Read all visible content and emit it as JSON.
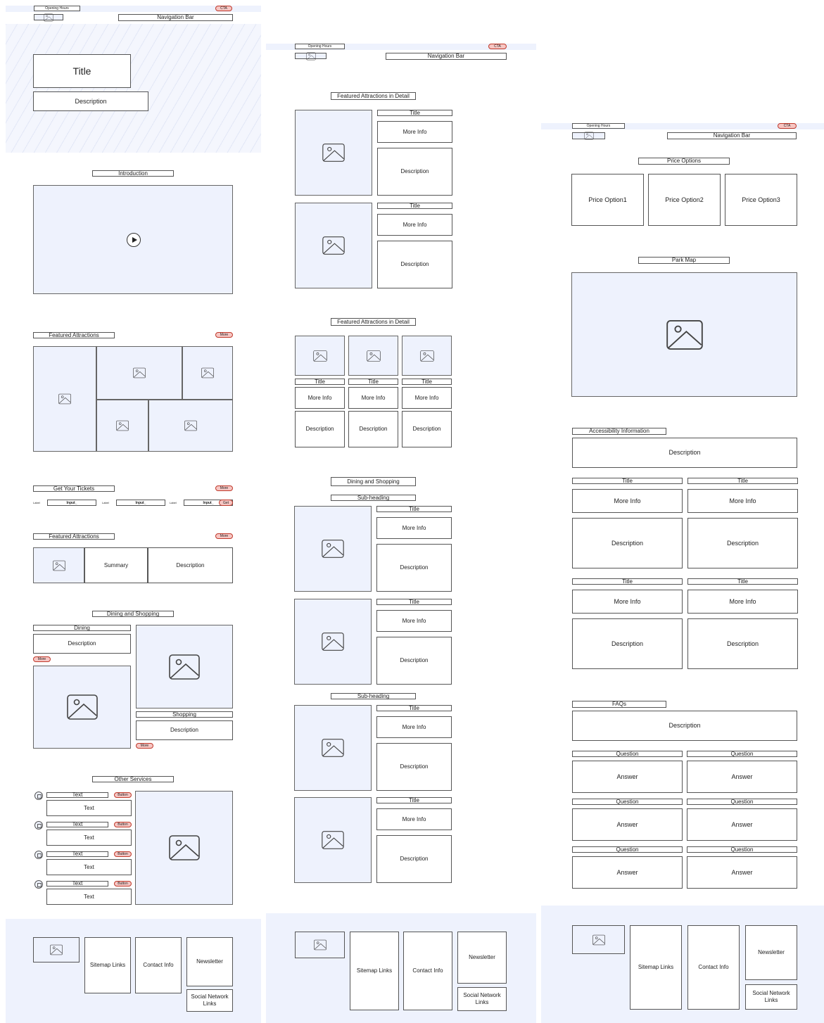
{
  "common": {
    "opening_hours": "Opening Hours",
    "cta": "CTA",
    "navigation_bar": "Navigation Bar",
    "more": "More",
    "title": "Title",
    "more_info": "More Info",
    "description": "Description",
    "footer": {
      "sitemap": "Sitemap Links",
      "contact": "Contact Info",
      "newsletter": "Newsletter",
      "social": "Social Network Links"
    }
  },
  "page1": {
    "hero_title": "Title",
    "hero_description": "Description",
    "introduction": "Introduction",
    "featured_attractions": "Featured Attractions",
    "get_tickets": "Get Your Tickets",
    "label": "Label",
    "input": "Input_",
    "get": "Get",
    "summary": "Summary",
    "dining_and_shopping": "Dining and Shopping",
    "dining": "Dining",
    "shopping": "Shopping",
    "other_services": "Other Services",
    "text": "Text",
    "button": "Button"
  },
  "page2": {
    "featured_detail": "Featured Attractions in Detail",
    "dining_and_shopping": "Dining and Shopping",
    "sub_heading": "Sub-heading"
  },
  "page3": {
    "price_options": "Price Options",
    "price_option_1": "Price Option1",
    "price_option_2": "Price Option2",
    "price_option_3": "Price Option3",
    "park_map": "Park Map",
    "accessibility": "Accessibility Information",
    "faqs": "FAQs",
    "question": "Question",
    "answer": "Answer"
  },
  "colors": {
    "placeholder_fill": "#eef2fd",
    "cta_fill": "#f6c6c3",
    "cta_border": "#c0392b"
  }
}
